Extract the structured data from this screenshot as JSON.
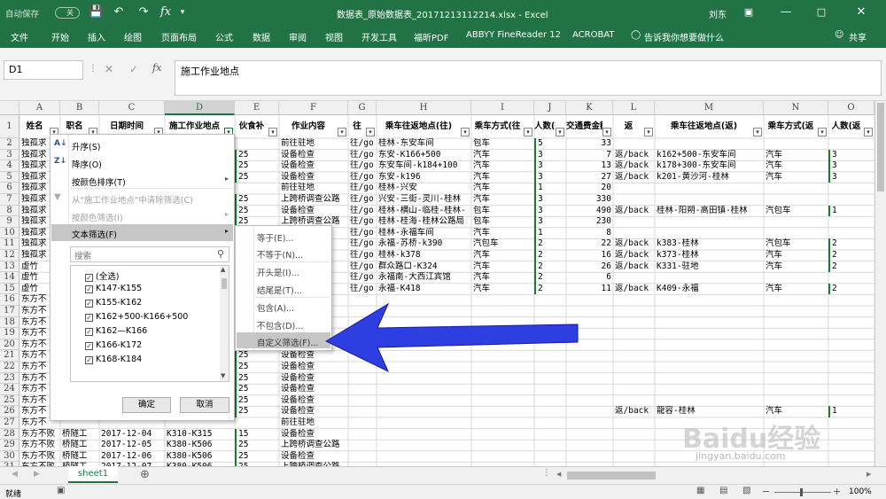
{
  "titlebar": {
    "autosave_label": "自动保存",
    "autosave_state": "关",
    "title": "数据表_原始数据表_20171213112214.xlsx  -  Excel",
    "user": "刘东"
  },
  "ribbon": {
    "tabs": [
      "文件",
      "开始",
      "插入",
      "绘图",
      "页面布局",
      "公式",
      "数据",
      "审阅",
      "视图",
      "开发工具",
      "福昕PDF",
      "ABBYY FineReader 12",
      "ACROBAT"
    ],
    "tell_me": "告诉我你想要做什么",
    "share": "共享"
  },
  "formula_bar": {
    "name_box": "D1",
    "fx": "fx",
    "value": "施工作业地点"
  },
  "columns": [
    "A",
    "B",
    "C",
    "D",
    "E",
    "F",
    "G",
    "H",
    "I",
    "J",
    "K",
    "L",
    "M",
    "N",
    "O"
  ],
  "headers": [
    "姓名",
    "职名",
    "日期时间",
    "施工作业地点",
    "伙食补",
    "作业内容",
    "往",
    "乘车往返地点(往)",
    "乘车方式(往",
    "人数(往",
    "交通费金额",
    "返",
    "乘车往返地点(返)",
    "乘车方式(返",
    "人数(返"
  ],
  "row_numbers": [
    "1",
    "2",
    "3",
    "4",
    "5",
    "6",
    "7",
    "8",
    "9",
    "10",
    "11",
    "12",
    "13",
    "14",
    "15",
    "16",
    "17",
    "18",
    "19",
    "20",
    "21",
    "22",
    "23",
    "24",
    "25",
    "26",
    "27",
    "28",
    "29",
    "30",
    "31"
  ],
  "rows": [
    [
      "独孤求",
      "",
      "",
      "",
      "",
      "前往驻地",
      "往/go",
      "桂林-东安车间",
      "包车",
      "5",
      "33",
      "",
      "",
      "",
      ""
    ],
    [
      "独孤求",
      "",
      "",
      "",
      "25",
      "设备检查",
      "往/go",
      "东安-K166+500",
      "汽车",
      "3",
      "7",
      "返/back",
      "k162+500-东安车间",
      "汽车",
      "3"
    ],
    [
      "独孤求",
      "",
      "",
      "",
      "25",
      "设备检查",
      "往/go",
      "东安车间-k184+100",
      "汽车",
      "3",
      "13",
      "返/back",
      "k178+300-东安车间",
      "汽车",
      "3"
    ],
    [
      "独孤求",
      "",
      "",
      "",
      "25",
      "设备检查",
      "往/go",
      "东安-k196",
      "汽车",
      "3",
      "27",
      "返/back",
      "k201-黄沙河-桂林",
      "汽车",
      "3"
    ],
    [
      "独孤求",
      "",
      "",
      "",
      "",
      "前往驻地",
      "往/go",
      "桂林-兴安",
      "汽车",
      "1",
      "20",
      "",
      "",
      "",
      ""
    ],
    [
      "独孤求",
      "",
      "",
      "",
      "25",
      "上跨桥调查公路",
      "往/go",
      "兴安-三街-灵川-桂林",
      "汽车",
      "3",
      "330",
      "",
      "",
      "",
      ""
    ],
    [
      "独孤求",
      "",
      "",
      "",
      "25",
      "设备检查",
      "往/go",
      "桂林-横山-临桂-桂林-",
      "包车",
      "3",
      "490",
      "返/back",
      "桂林-阳朔-高田镇-桂林",
      "汽包车",
      "1"
    ],
    [
      "独孤求",
      "",
      "",
      "",
      "25",
      "上跨桥调查公路",
      "往/go",
      "桂林-桂海-桂林公路局",
      "包车",
      "3",
      "230",
      "",
      "",
      "",
      ""
    ],
    [
      "独孤求",
      "",
      "",
      "",
      "",
      "",
      "往/go",
      "桂林-永福车间",
      "汽车",
      "1",
      "8",
      "",
      "",
      "",
      ""
    ],
    [
      "独孤求",
      "",
      "",
      "",
      "",
      "",
      "往/go",
      "永福-苏桥-k390",
      "汽包车",
      "2",
      "22",
      "返/back",
      "k383-桂林",
      "汽包车",
      "2"
    ],
    [
      "独孤求",
      "",
      "",
      "",
      "",
      "",
      "往/go",
      "桂林-k378",
      "汽车",
      "2",
      "16",
      "返/back",
      "k373-桂林",
      "汽车",
      "2"
    ],
    [
      "虚竹",
      "",
      "",
      "",
      "",
      "",
      "往/go",
      "群众路口-K324",
      "汽车",
      "2",
      "26",
      "返/back",
      "K331-驻地",
      "汽车",
      "2"
    ],
    [
      "虚竹",
      "",
      "",
      "",
      "",
      "",
      "往/go",
      "永福南-大西江宾馆",
      "汽车",
      "2",
      "6",
      "",
      "",
      "",
      ""
    ],
    [
      "虚竹",
      "",
      "",
      "",
      "",
      "",
      "往/go",
      "永福-K418",
      "汽车",
      "2",
      "11",
      "返/back",
      "K409-永福",
      "汽车",
      "2"
    ],
    [
      "东方不",
      "",
      "",
      "",
      "",
      "",
      "",
      "",
      "",
      "",
      "",
      "",
      "",
      "",
      ""
    ],
    [
      "东方不",
      "",
      "",
      "",
      "",
      "",
      "",
      "",
      "",
      "",
      "",
      "",
      "",
      "",
      ""
    ],
    [
      "东方不",
      "",
      "",
      "",
      "",
      "",
      "",
      "",
      "",
      "",
      "",
      "",
      "",
      "",
      ""
    ],
    [
      "东方不",
      "",
      "",
      "",
      "",
      "",
      "",
      "",
      "",
      "",
      "",
      "",
      "",
      "",
      ""
    ],
    [
      "东方不",
      "",
      "",
      "",
      "",
      "",
      "",
      "",
      "",
      "",
      "",
      "",
      "",
      "",
      ""
    ],
    [
      "东方不",
      "",
      "",
      "",
      "25",
      "设备检查",
      "",
      "",
      "",
      "",
      "",
      "",
      "",
      "",
      ""
    ],
    [
      "东方不",
      "",
      "",
      "",
      "25",
      "设备检查",
      "",
      "",
      "",
      "",
      "",
      "",
      "",
      "",
      ""
    ],
    [
      "东方不",
      "",
      "",
      "",
      "25",
      "设备检查",
      "",
      "",
      "",
      "",
      "",
      "",
      "",
      "",
      ""
    ],
    [
      "东方不",
      "",
      "",
      "",
      "25",
      "设备检查",
      "",
      "",
      "",
      "",
      "",
      "",
      "",
      "",
      ""
    ],
    [
      "东方不",
      "",
      "",
      "",
      "25",
      "设备检查",
      "",
      "",
      "",
      "",
      "",
      "",
      "",
      "",
      ""
    ],
    [
      "东方不",
      "",
      "",
      "",
      "25",
      "设备检查",
      "",
      "",
      "",
      "",
      "",
      "返/back",
      "龍容-桂林",
      "汽车",
      "1"
    ],
    [
      "东方不",
      "",
      "",
      "",
      "",
      "前往驻地",
      "",
      "",
      "",
      "",
      "",
      "",
      "",
      "",
      ""
    ],
    [
      "东方不败",
      "桥隧工",
      "2017-12-04",
      "K310-K315",
      "15",
      "设备检查",
      "",
      "",
      "",
      "",
      "",
      "",
      "",
      "",
      ""
    ],
    [
      "东方不败",
      "桥隧工",
      "2017-12-05",
      "K380-K506",
      "25",
      "上跨桥调查公路",
      "",
      "",
      "",
      "",
      "",
      "",
      "",
      "",
      ""
    ],
    [
      "东方不败",
      "桥隧工",
      "2017-12-06",
      "K380-K506",
      "25",
      "设备检查",
      "",
      "",
      "",
      "",
      "",
      "",
      "",
      "",
      ""
    ],
    [
      "东方不败",
      "桥隧工",
      "2017-12-07",
      "K380-K506",
      "25",
      "上跨桥调查公路",
      "",
      "",
      "",
      "",
      "",
      "",
      "",
      "",
      ""
    ]
  ],
  "filter_menu": {
    "sort_asc": "升序(S)",
    "sort_desc": "降序(O)",
    "sort_color": "按颜色排序(T)",
    "clear_filter": "从\"施工作业地点\"中清除筛选(C)",
    "filter_color": "按颜色筛选(I)",
    "text_filter": "文本筛选(F)",
    "search_placeholder": "搜索",
    "checklist": [
      "(全选)",
      "K147-K155",
      "K155-K162",
      "K162+500-K166+500",
      "K162—K166",
      "K166-K172",
      "K168-K184"
    ],
    "ok": "确定",
    "cancel": "取消"
  },
  "text_filter_submenu": [
    "等于(E)...",
    "不等于(N)...",
    "开头是(I)...",
    "结尾是(T)...",
    "包含(A)...",
    "不包含(D)...",
    "自定义筛选(F)..."
  ],
  "sheet_tab": "sheet1",
  "status": {
    "left": "就绪",
    "zoom": "100%"
  },
  "watermark": {
    "text": "Baidu经验",
    "url": "jingyan.baidu.com"
  },
  "colors": {
    "excel_green": "#217346",
    "arrow_blue": "#2d3fe0",
    "check_green": "#1a7c2e"
  }
}
